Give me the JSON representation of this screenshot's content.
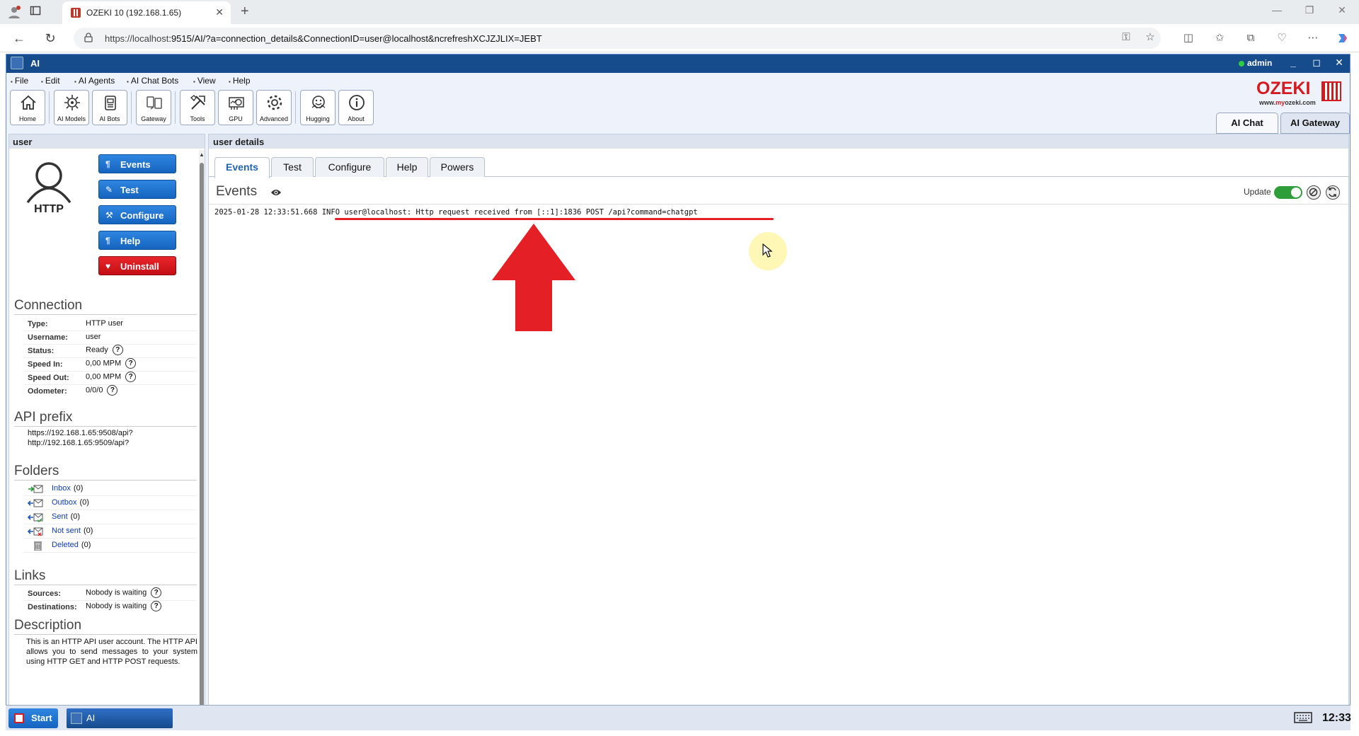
{
  "browser": {
    "tab_title": "OZEKI 10 (192.168.1.65)",
    "url_host": "https://localhost",
    "url_rest": ":9515/AI/?a=connection_details&ConnectionID=user@localhost&ncrefreshXCJZJLIX=JEBT"
  },
  "app": {
    "title": "AI",
    "user": "admin"
  },
  "menu": [
    "File",
    "Edit",
    "AI Agents",
    "AI Chat Bots",
    "View",
    "Help"
  ],
  "toolbar": {
    "home": "Home",
    "ai_models": "AI Models",
    "ai_bots": "AI Bots",
    "gateway": "Gateway",
    "tools": "Tools",
    "gpu": "GPU",
    "advanced": "Advanced",
    "hugging": "Hugging",
    "about": "About"
  },
  "logo": {
    "word": "OZEKI",
    "site_prefix": "www.",
    "site_brand": "my",
    "site_rest": "ozeki.com"
  },
  "top_tabs": {
    "ai_chat": "AI Chat",
    "ai_gateway": "AI Gateway"
  },
  "left": {
    "header": "user",
    "avatar_text": "HTTP",
    "buttons": {
      "events": "Events",
      "test": "Test",
      "configure": "Configure",
      "help": "Help",
      "uninstall": "Uninstall"
    },
    "connection": {
      "title": "Connection",
      "type_label": "Type:",
      "type_value": "HTTP user",
      "username_label": "Username:",
      "username_value": "user",
      "status_label": "Status:",
      "status_value": "Ready",
      "speed_in_label": "Speed In:",
      "speed_in_value": "0,00 MPM",
      "speed_out_label": "Speed Out:",
      "speed_out_value": "0,00 MPM",
      "odometer_label": "Odometer:",
      "odometer_value": "0/0/0"
    },
    "api_prefix": {
      "title": "API prefix",
      "https": "https://192.168.1.65:9508/api?",
      "http": "http://192.168.1.65:9509/api?"
    },
    "folders": {
      "title": "Folders",
      "inbox": "Inbox",
      "inbox_count": "(0)",
      "outbox": "Outbox",
      "outbox_count": "(0)",
      "sent": "Sent",
      "sent_count": "(0)",
      "not_sent": "Not sent",
      "not_sent_count": "(0)",
      "deleted": "Deleted",
      "deleted_count": "(0)"
    },
    "links": {
      "title": "Links",
      "sources_label": "Sources:",
      "sources_value": "Nobody is waiting",
      "destinations_label": "Destinations:",
      "destinations_value": "Nobody is waiting"
    },
    "description": {
      "title": "Description",
      "text": "This is an HTTP API user account. The HTTP API allows you to send messages to your system using HTTP GET and HTTP POST requests."
    }
  },
  "main": {
    "header": "user details",
    "tabs": {
      "events": "Events",
      "test": "Test",
      "configure": "Configure",
      "help": "Help",
      "powers": "Powers"
    },
    "events_title": "Events",
    "update_label": "Update",
    "update_on": true,
    "log_timestamp": "2025-01-28 12:33:51.668",
    "log_message": "INFO user@localhost: Http request received from [::1]:1836 POST /api?command=chatgpt"
  },
  "taskbar": {
    "start": "Start",
    "task_ai": "AI",
    "clock": "12:33"
  },
  "colors": {
    "accent": "#1564c0",
    "brand_red": "#d71920",
    "annotation_red": "#e41f26",
    "titlebar": "#164b8c"
  }
}
